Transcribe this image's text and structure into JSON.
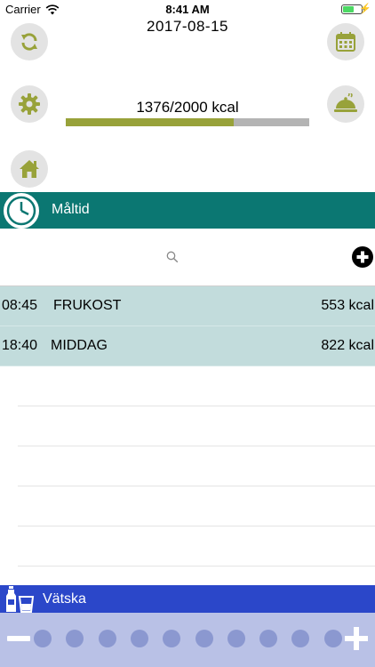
{
  "status_bar": {
    "carrier": "Carrier",
    "time": "8:41 AM"
  },
  "header": {
    "date": "2017-08-15"
  },
  "calories": {
    "label": "1376/2000 kcal",
    "consumed": 1376,
    "goal": 2000
  },
  "meal_section": {
    "title": "Måltid"
  },
  "meals": [
    {
      "time": "08:45",
      "name": "FRUKOST",
      "kcal": "553 kcal"
    },
    {
      "time": "18:40",
      "name": "MIDDAG",
      "kcal": "822 kcal"
    }
  ],
  "liquid_section": {
    "title": "Vätska",
    "glasses_total": 10,
    "glasses_filled": 0
  },
  "colors": {
    "meal_header": "#0b7772",
    "meal_row": "#c2dcdc",
    "liquid_header": "#2b47c9",
    "liquid_bar": "#b9c1e6",
    "accent_olive": "#98a23a"
  },
  "icons": {
    "sync": "sync-icon",
    "calendar": "calendar-icon",
    "settings": "gear-icon",
    "food": "cloche-icon",
    "home": "home-icon",
    "clock": "clock-icon",
    "search": "search-icon",
    "add": "add-circle-icon",
    "liquid": "bottle-glass-icon"
  }
}
